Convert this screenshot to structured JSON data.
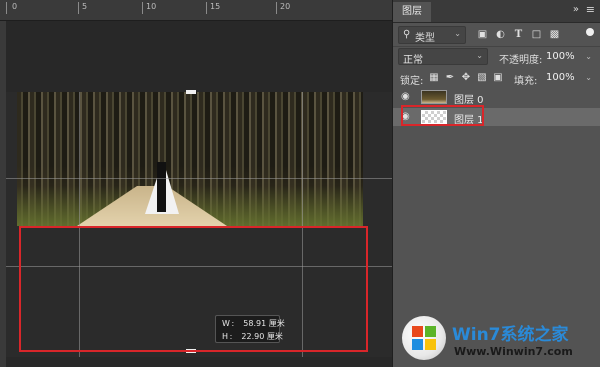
{
  "canvas": {
    "ruler_labels": [
      "0",
      "5",
      "10",
      "15",
      "20"
    ],
    "tooltip": {
      "w_label": "W :",
      "w_value": "58.91",
      "w_unit": "厘米",
      "h_label": "H :",
      "h_value": "22.90",
      "h_unit": "厘米"
    }
  },
  "layers_panel": {
    "tab_label": "图层",
    "collapse_icon": "double-chevron",
    "menu_icon": "hamburger",
    "filter": {
      "label": "类型",
      "icon": "search-icon"
    },
    "filter_icons": [
      "image-filter-icon",
      "adjustment-filter-icon",
      "text-filter-icon",
      "shape-filter-icon",
      "smart-object-filter-icon"
    ],
    "blend_mode": "正常",
    "opacity_label": "不透明度:",
    "opacity_value": "100%",
    "lock_label": "锁定:",
    "lock_icons": [
      "lock-transparent-icon",
      "lock-image-icon",
      "lock-position-icon",
      "lock-artboard-icon",
      "lock-all-icon"
    ],
    "fill_label": "填充:",
    "fill_value": "100%",
    "layers": [
      {
        "name": "图层 0",
        "visible": true,
        "selected": false
      },
      {
        "name": "图层 1",
        "visible": true,
        "selected": true
      }
    ]
  },
  "watermark": {
    "title_en": "Win7",
    "title_cn": "系统之家",
    "url": "Www.Winwin7.com"
  },
  "colors": {
    "highlight_red": "#d9262a",
    "panel_bg": "#535353",
    "canvas_bg": "#282828"
  }
}
